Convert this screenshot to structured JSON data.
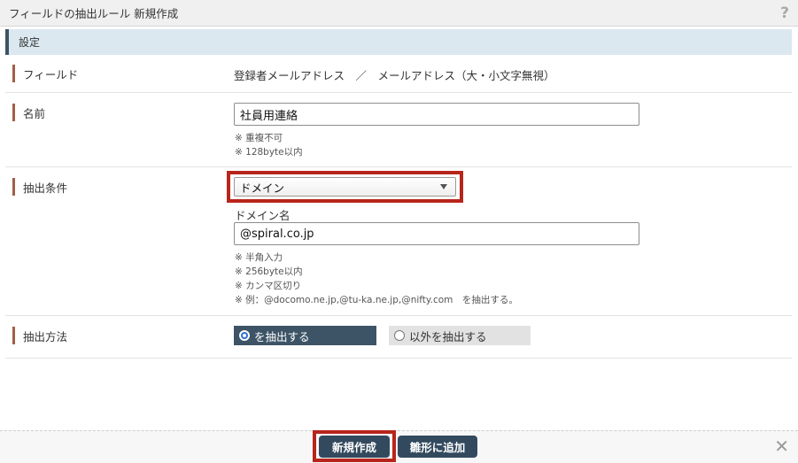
{
  "dialog": {
    "title": "フィールドの抽出ルール 新規作成"
  },
  "section": {
    "title": "設定"
  },
  "rows": {
    "field": {
      "label": "フィールド",
      "value": "登録者メールアドレス　／　メールアドレス（大・小文字無視）"
    },
    "name": {
      "label": "名前",
      "value": "社員用連絡",
      "notes": [
        "※ 重複不可",
        "※ 128byte以内"
      ]
    },
    "condition": {
      "label": "抽出条件",
      "selected": "ドメイン",
      "sublabel": "ドメイン名",
      "value": "@spiral.co.jp",
      "notes": [
        "※ 半角入力",
        "※ 256byte以内",
        "※ カンマ区切り",
        "※ 例：@docomo.ne.jp,@tu-ka.ne.jp,@nifty.com　を抽出する。"
      ]
    },
    "method": {
      "label": "抽出方法",
      "options": [
        "を抽出する",
        "以外を抽出する"
      ],
      "selected_index": 0
    }
  },
  "footer": {
    "create_label": "新規作成",
    "template_label": "雛形に追加"
  },
  "icons": {
    "help": "help-icon",
    "close": "close-icon"
  },
  "colors": {
    "accent": "#3d5467",
    "highlight": "#b8251b",
    "label_bar": "#a35f48",
    "section_bg": "#dbe8f0"
  }
}
